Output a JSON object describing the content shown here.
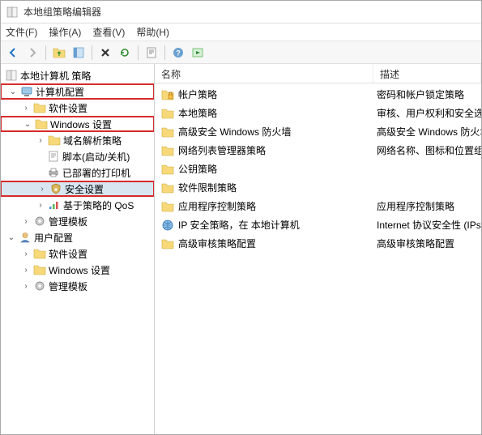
{
  "window": {
    "title": "本地组策略编辑器"
  },
  "menu": {
    "file": "文件(F)",
    "action": "操作(A)",
    "view": "查看(V)",
    "help": "帮助(H)"
  },
  "toolbar_icons": {
    "back": "back-arrow",
    "forward": "forward-arrow",
    "up": "up-folder",
    "show": "show-pane",
    "delete": "delete-x",
    "refresh": "refresh",
    "properties": "properties-sheet",
    "help": "help-q",
    "run": "run-media"
  },
  "columns": {
    "name": "名称",
    "description": "描述"
  },
  "tree": {
    "root": "本地计算机 策略",
    "computer_config": "计算机配置",
    "computer_children": {
      "software": "软件设置",
      "windows": "Windows 设置",
      "windows_children": {
        "dns": "域名解析策略",
        "scripts": "脚本(启动/关机)",
        "printers": "已部署的打印机",
        "security": "安全设置",
        "qos": "基于策略的 QoS"
      },
      "admin_templates": "管理模板"
    },
    "user_config": "用户配置",
    "user_children": {
      "software": "软件设置",
      "windows": "Windows 设置",
      "admin_templates": "管理模板"
    }
  },
  "list": [
    {
      "name": "帐户策略",
      "desc": "密码和帐户锁定策略",
      "icon": "folder-lock"
    },
    {
      "name": "本地策略",
      "desc": "审核、用户权利和安全选项",
      "icon": "folder"
    },
    {
      "name": "高级安全 Windows 防火墙",
      "desc": "高级安全 Windows 防火墙",
      "icon": "folder"
    },
    {
      "name": "网络列表管理器策略",
      "desc": "网络名称、图标和位置组策略",
      "icon": "folder"
    },
    {
      "name": "公钥策略",
      "desc": "",
      "icon": "folder"
    },
    {
      "name": "软件限制策略",
      "desc": "",
      "icon": "folder"
    },
    {
      "name": "应用程序控制策略",
      "desc": "应用程序控制策略",
      "icon": "folder"
    },
    {
      "name": "IP 安全策略，在 本地计算机",
      "desc": "Internet 协议安全性 (IPsec)",
      "icon": "ipsec"
    },
    {
      "name": "高级审核策略配置",
      "desc": "高级审核策略配置",
      "icon": "folder"
    }
  ]
}
